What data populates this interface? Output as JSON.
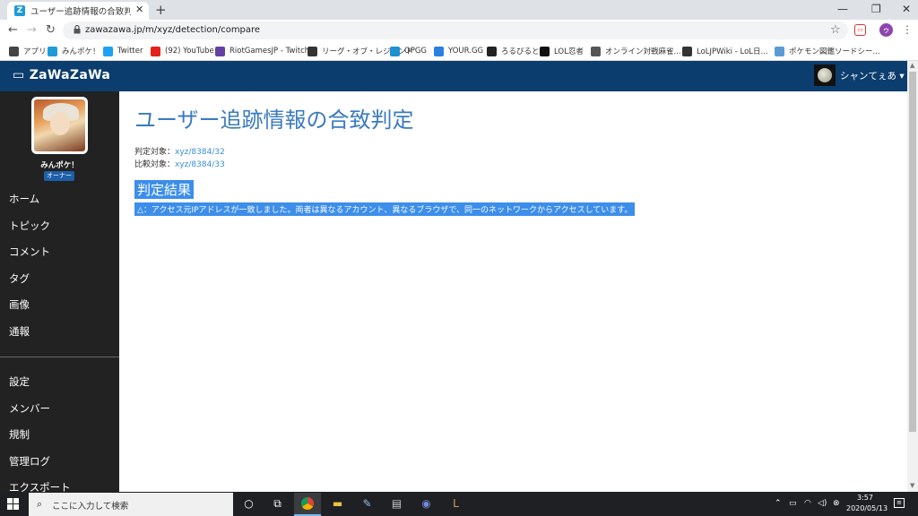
{
  "browser": {
    "tab_title": "ユーザー追跡情報の合致判定 @みん",
    "tab_close": "✕",
    "new_tab": "+",
    "url": "zawazawa.jp/m/xyz/detection/compare",
    "bookmarks": [
      {
        "label": "アプリ",
        "icon": "apps-grid-icon",
        "color": "#444"
      },
      {
        "label": "みんポケ！",
        "icon": "zawazawa-icon",
        "color": "#1e9bd7"
      },
      {
        "label": "Twitter",
        "icon": "twitter-icon",
        "color": "#1da1f2"
      },
      {
        "label": "(92) YouTube",
        "icon": "youtube-icon",
        "color": "#e62117"
      },
      {
        "label": "RiotGamesJP - Twitch",
        "icon": "twitch-icon",
        "color": "#6441a5"
      },
      {
        "label": "リーグ・オブ・レジェンド",
        "icon": "lol-icon",
        "color": "#333"
      },
      {
        "label": "OPGG",
        "icon": "opgg-icon",
        "color": "#1e90d0"
      },
      {
        "label": "YOUR.GG",
        "icon": "yourgg-icon",
        "color": "#2b7fe0"
      },
      {
        "label": "ろるびると",
        "icon": "lolvirt-icon",
        "color": "#222"
      },
      {
        "label": "LOL忍者",
        "icon": "ninja-icon",
        "color": "#111"
      },
      {
        "label": "オンライン対戦麻雀...",
        "icon": "mahjong-icon",
        "color": "#555"
      },
      {
        "label": "LoLJPWiki - LoL日...",
        "icon": "wiki-icon",
        "color": "#333"
      },
      {
        "label": "ポケモン図鑑ソードシー...",
        "icon": "pokemon-icon",
        "color": "#5b9bd5"
      }
    ]
  },
  "site": {
    "logo": "ZaWaZaWa",
    "user_name": "シャンてぇあ ▾",
    "sidebar": {
      "username": "みんポケ！",
      "badge": "オーナー",
      "nav_primary": [
        "ホーム",
        "トピック",
        "コメント",
        "タグ",
        "画像",
        "通報"
      ],
      "nav_secondary": [
        "設定",
        "メンバー",
        "規制",
        "管理ログ",
        "エクスポート"
      ]
    }
  },
  "main": {
    "title": "ユーザー追跡情報の合致判定",
    "target_label": "判定対象：",
    "target_link": "xyz/8384/32",
    "compare_label": "比較対象：",
    "compare_link": "xyz/8384/33",
    "result_heading": "判定結果",
    "result_text": "△：アクセス元IPアドレスが一致しました。両者は異なるアカウント、異なるブラウザで、同一のネットワークからアクセスしています。"
  },
  "taskbar": {
    "search_placeholder": "ここに入力して検索",
    "time": "3:57",
    "date": "2020/05/13"
  }
}
